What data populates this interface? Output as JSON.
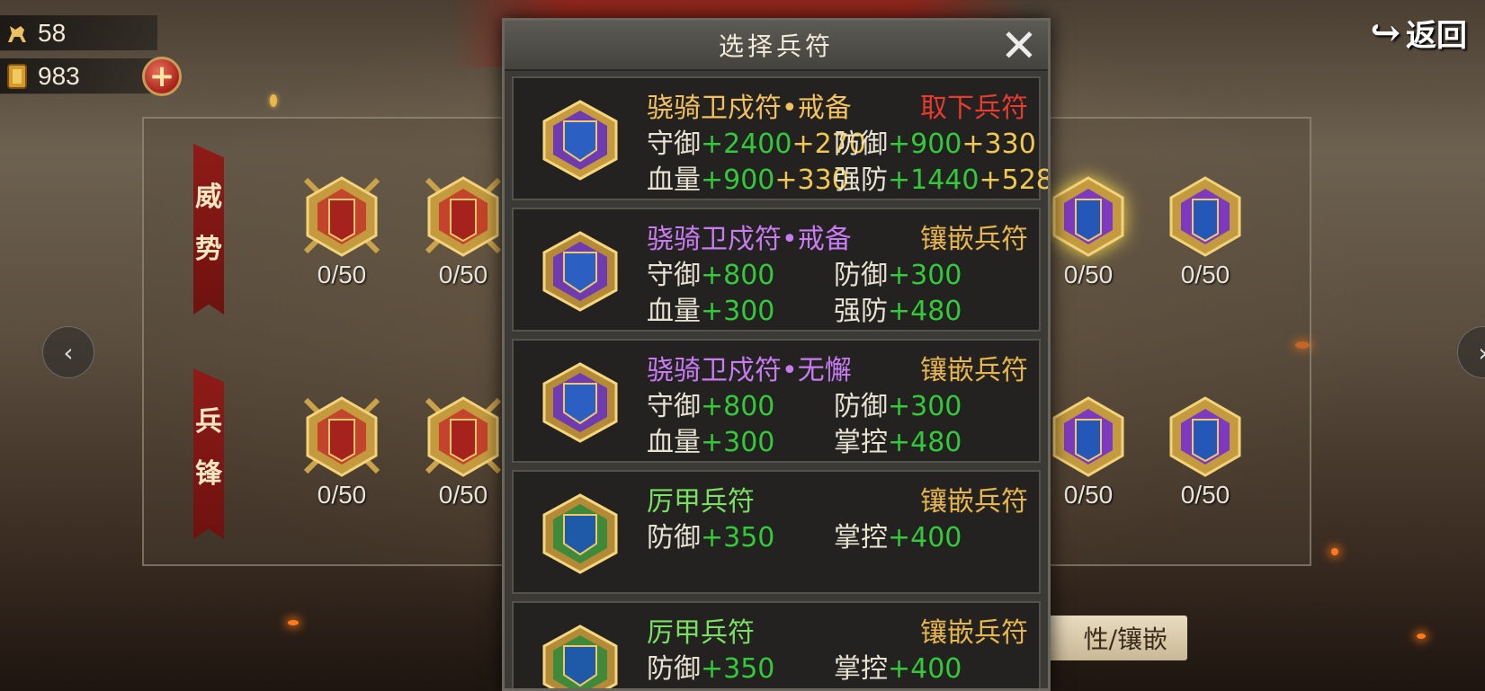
{
  "resources": {
    "horse_count": "58",
    "token_count": "983"
  },
  "top_right": {
    "back_label": "返回"
  },
  "grid": {
    "row1_label": [
      "威",
      "势"
    ],
    "row2_label": [
      "兵",
      "锋"
    ],
    "count_label": "0/50",
    "attr_button_label": "性/镶嵌"
  },
  "modal": {
    "title": "选择兵符",
    "close_symbol": "✕",
    "cards": [
      {
        "name": "骁骑卫戍符•戒备",
        "action": "取下兵符",
        "stats": [
          {
            "label": "守御",
            "base": "+2400",
            "extra": "+270"
          },
          {
            "label": "防御",
            "base": "+900",
            "extra": "+330"
          },
          {
            "label": "血量",
            "base": "+900",
            "extra": "+330"
          },
          {
            "label": "强防",
            "base": "+1440",
            "extra": "+528"
          }
        ]
      },
      {
        "name": "骁骑卫戍符•戒备",
        "action": "镶嵌兵符",
        "stats": [
          {
            "label": "守御",
            "base": "+800"
          },
          {
            "label": "防御",
            "base": "+300"
          },
          {
            "label": "血量",
            "base": "+300"
          },
          {
            "label": "强防",
            "base": "+480"
          }
        ]
      },
      {
        "name": "骁骑卫戍符•无懈",
        "action": "镶嵌兵符",
        "stats": [
          {
            "label": "守御",
            "base": "+800"
          },
          {
            "label": "防御",
            "base": "+300"
          },
          {
            "label": "血量",
            "base": "+300"
          },
          {
            "label": "掌控",
            "base": "+480"
          }
        ]
      },
      {
        "name": "厉甲兵符",
        "action": "镶嵌兵符",
        "stats": [
          {
            "label": "防御",
            "base": "+350"
          },
          {
            "label": "掌控",
            "base": "+400"
          }
        ]
      },
      {
        "name": "厉甲兵符",
        "action": "镶嵌兵符",
        "stats": [
          {
            "label": "防御",
            "base": "+350"
          },
          {
            "label": "掌控",
            "base": "+400"
          }
        ]
      }
    ]
  },
  "colors": {
    "bonus_green": "#32c93a",
    "bonus_yellow": "#f0c850",
    "remove_red": "#e63b2e",
    "action_gold": "#e7b64b",
    "orange_name": "#f2c15c",
    "purple_name": "#c77cf2",
    "green_name": "#7ae062"
  }
}
